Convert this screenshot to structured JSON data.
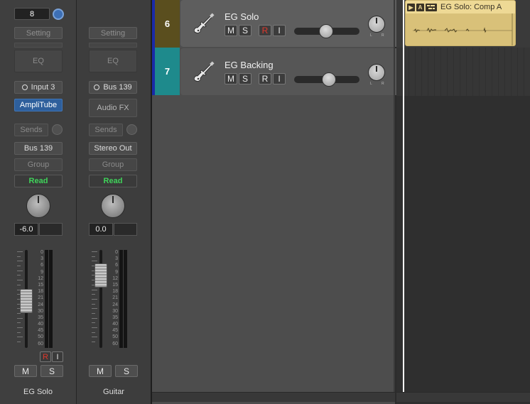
{
  "mixer": {
    "strips": [
      {
        "id": "eg-solo",
        "channel_number": "8",
        "setting_label": "Setting",
        "eq_label": "EQ",
        "input_label": "Input 3",
        "plugin_label": "AmpliTube",
        "sends_label": "Sends",
        "output_label": "Bus 139",
        "group_label": "Group",
        "automation_label": "Read",
        "volume_value": "-6.0",
        "volume_db": -6.0,
        "record_label": "R",
        "input_monitor_label": "I",
        "mute_label": "M",
        "solo_label": "S",
        "name": "EG Solo"
      },
      {
        "id": "guitar",
        "setting_label": "Setting",
        "eq_label": "EQ",
        "input_label": "Bus 139",
        "plugin_label": "Audio FX",
        "sends_label": "Sends",
        "output_label": "Stereo Out",
        "group_label": "Group",
        "automation_label": "Read",
        "volume_value": "0.0",
        "volume_db": 0.0,
        "mute_label": "M",
        "solo_label": "S",
        "name": "Guitar"
      }
    ],
    "fader_scale": [
      "0",
      "3",
      "6",
      "9",
      "12",
      "15",
      "18",
      "21",
      "24",
      "30",
      "35",
      "40",
      "45",
      "50",
      "60"
    ]
  },
  "tracks": [
    {
      "number": "6",
      "name": "EG Solo",
      "mute_label": "M",
      "solo_label": "S",
      "record_label": "R",
      "input_label": "I",
      "color": "#5a4e1e",
      "selected": true
    },
    {
      "number": "7",
      "name": "EG Backing",
      "mute_label": "M",
      "solo_label": "S",
      "record_label": "R",
      "input_label": "I",
      "color": "#1e8a8c",
      "selected": false
    }
  ],
  "pan_labels": {
    "left": "L",
    "right": "R"
  },
  "timeline": {
    "region_title": "EG Solo: Comp A",
    "region_icons": [
      "▶",
      "A",
      "comp-icon"
    ],
    "region_color": "#e8d189"
  }
}
